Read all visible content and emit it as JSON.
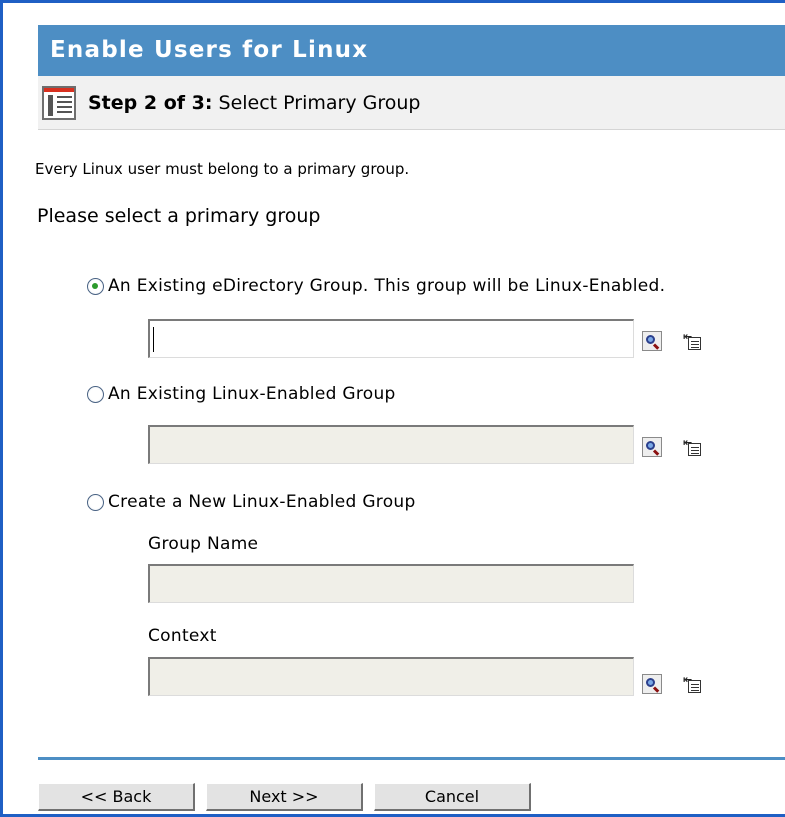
{
  "title": "Enable Users for Linux",
  "step": {
    "label": "Step 2 of 3:",
    "description": "Select Primary Group"
  },
  "intro_text": "Every Linux user must belong to a primary group.",
  "heading": "Please select a primary group",
  "options": {
    "existing_edirectory": {
      "label": "An Existing eDirectory Group. This group will be Linux-Enabled.",
      "selected": true,
      "value": ""
    },
    "existing_linux": {
      "label": "An Existing Linux-Enabled Group",
      "selected": false,
      "value": ""
    },
    "create_new": {
      "label": "Create a New Linux-Enabled Group",
      "selected": false,
      "group_name_label": "Group Name",
      "group_name_value": "",
      "context_label": "Context",
      "context_value": ""
    }
  },
  "icons": {
    "wizard": "wizard-step-icon",
    "search": "search-icon",
    "browse": "browse-icon"
  },
  "buttons": {
    "back": "<< Back",
    "next": "Next >>",
    "cancel": "Cancel"
  },
  "colors": {
    "title_bar": "#4d8ec4",
    "frame": "#1f5fc4",
    "radio_selected": "#2c9a2c"
  }
}
